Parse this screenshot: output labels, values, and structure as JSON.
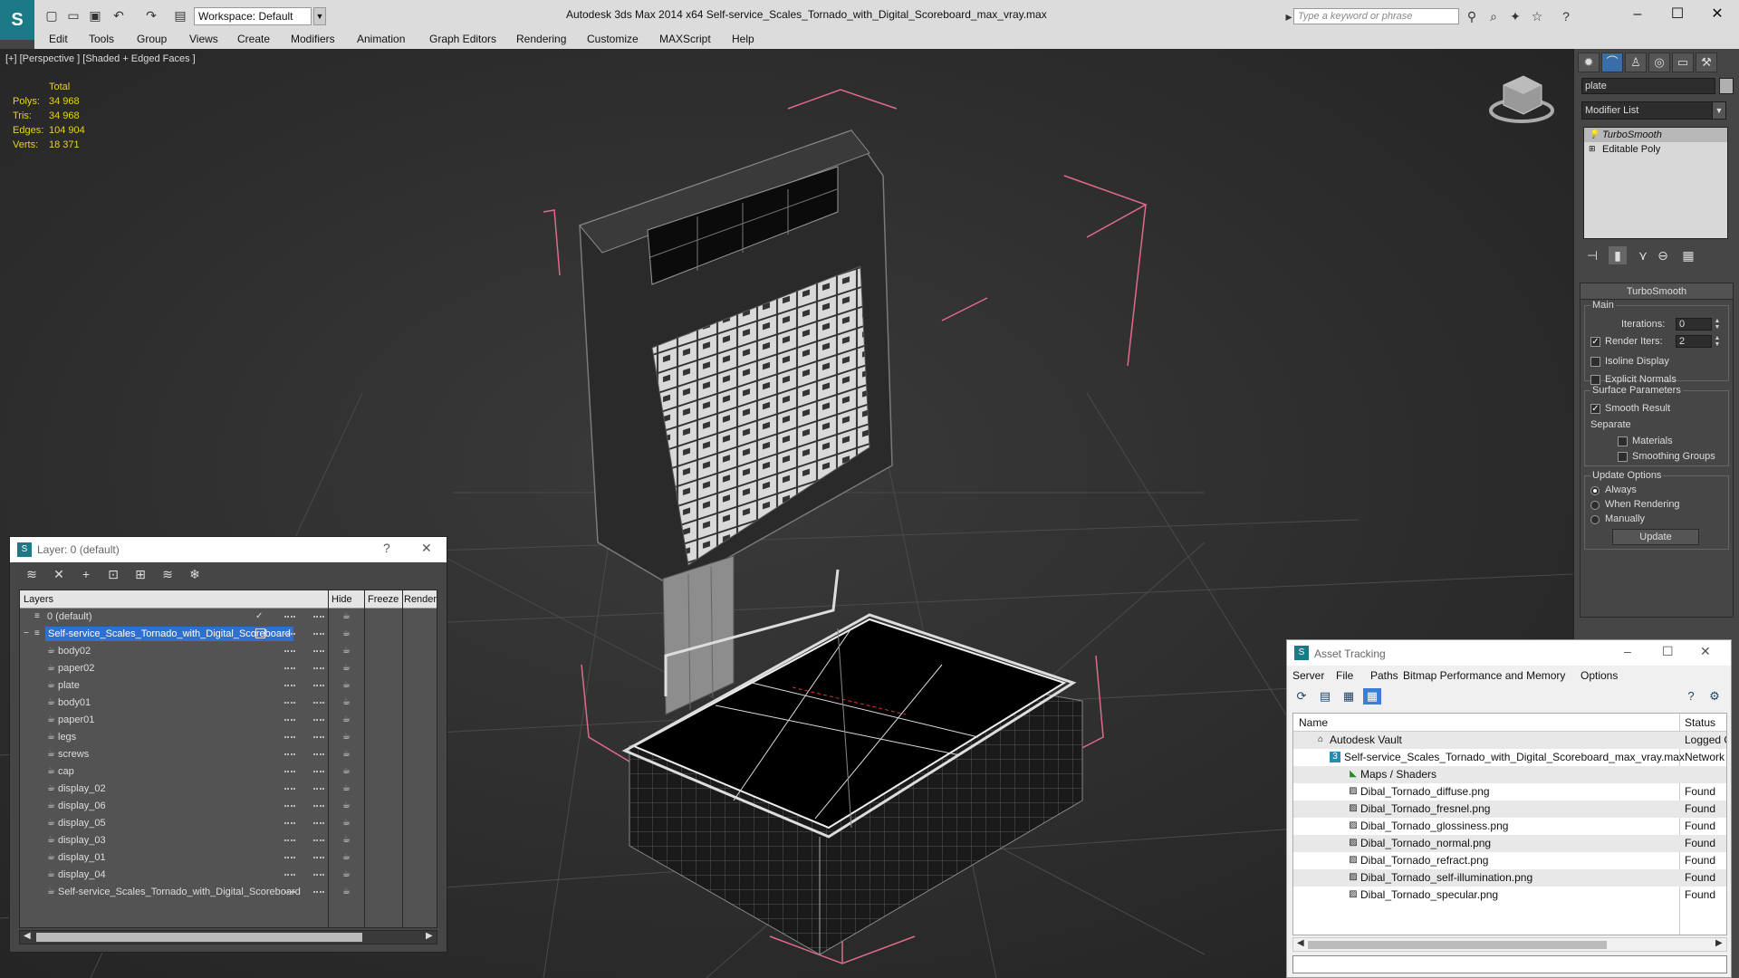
{
  "window": {
    "title": "Autodesk 3ds Max  2014 x64     Self-service_Scales_Tornado_with_Digital_Scoreboard_max_vray.max",
    "workspace": "Workspace: Default",
    "search_placeholder": "Type a keyword or phrase"
  },
  "menu": [
    "Edit",
    "Tools",
    "Group",
    "Views",
    "Create",
    "Modifiers",
    "Animation",
    "Graph Editors",
    "Rendering",
    "Customize",
    "MAXScript",
    "Help"
  ],
  "viewport": {
    "label": "[+] [Perspective ] [Shaded + Edged Faces ]",
    "stats": {
      "total_label": "Total",
      "rows": [
        {
          "label": "Polys:",
          "value": "34 968"
        },
        {
          "label": "Tris:",
          "value": "34 968"
        },
        {
          "label": "Edges:",
          "value": "104 904"
        },
        {
          "label": "Verts:",
          "value": "18 371"
        }
      ]
    }
  },
  "command_panel": {
    "object_name": "plate",
    "modifier_list": "Modifier List",
    "stack": [
      "TurboSmooth",
      "Editable Poly"
    ],
    "rollout_title": "TurboSmooth",
    "main_label": "Main",
    "iterations_label": "Iterations:",
    "iterations_value": "0",
    "render_iters_label": "Render Iters:",
    "render_iters_value": "2",
    "isoline_label": "Isoline Display",
    "explicit_normals_label": "Explicit Normals",
    "surface_params_label": "Surface Parameters",
    "smooth_result_label": "Smooth Result",
    "separate_label": "Separate",
    "materials_label": "Materials",
    "smoothing_groups_label": "Smoothing Groups",
    "update_options_label": "Update Options",
    "always_label": "Always",
    "when_rendering_label": "When Rendering",
    "manually_label": "Manually",
    "update_button": "Update"
  },
  "layer_dialog": {
    "title": "Layer: 0 (default)",
    "help": "?",
    "columns": {
      "layers": "Layers",
      "hide": "Hide",
      "freeze": "Freeze",
      "render": "Render"
    },
    "default_layer": "0 (default)",
    "selected_layer": "Self-service_Scales_Tornado_with_Digital_Scoreboard",
    "objects": [
      "body02",
      "paper02",
      "plate",
      "body01",
      "paper01",
      "legs",
      "screws",
      "cap",
      "display_02",
      "display_06",
      "display_05",
      "display_03",
      "display_01",
      "display_04",
      "Self-service_Scales_Tornado_with_Digital_Scoreboard"
    ]
  },
  "asset_tracking": {
    "title": "Asset Tracking",
    "menu": [
      "Server",
      "File",
      "Paths",
      "Bitmap Performance and Memory",
      "Options"
    ],
    "columns": {
      "name": "Name",
      "status": "Status"
    },
    "vault": {
      "name": "Autodesk Vault",
      "status": "Logged O"
    },
    "file": {
      "name": "Self-service_Scales_Tornado_with_Digital_Scoreboard_max_vray.max",
      "status": "Network F"
    },
    "maps_folder": "Maps / Shaders",
    "maps": [
      {
        "name": "Dibal_Tornado_diffuse.png",
        "status": "Found"
      },
      {
        "name": "Dibal_Tornado_fresnel.png",
        "status": "Found"
      },
      {
        "name": "Dibal_Tornado_glossiness.png",
        "status": "Found"
      },
      {
        "name": "Dibal_Tornado_normal.png",
        "status": "Found"
      },
      {
        "name": "Dibal_Tornado_refract.png",
        "status": "Found"
      },
      {
        "name": "Dibal_Tornado_self-illumination.png",
        "status": "Found"
      },
      {
        "name": "Dibal_Tornado_specular.png",
        "status": "Found"
      }
    ]
  }
}
